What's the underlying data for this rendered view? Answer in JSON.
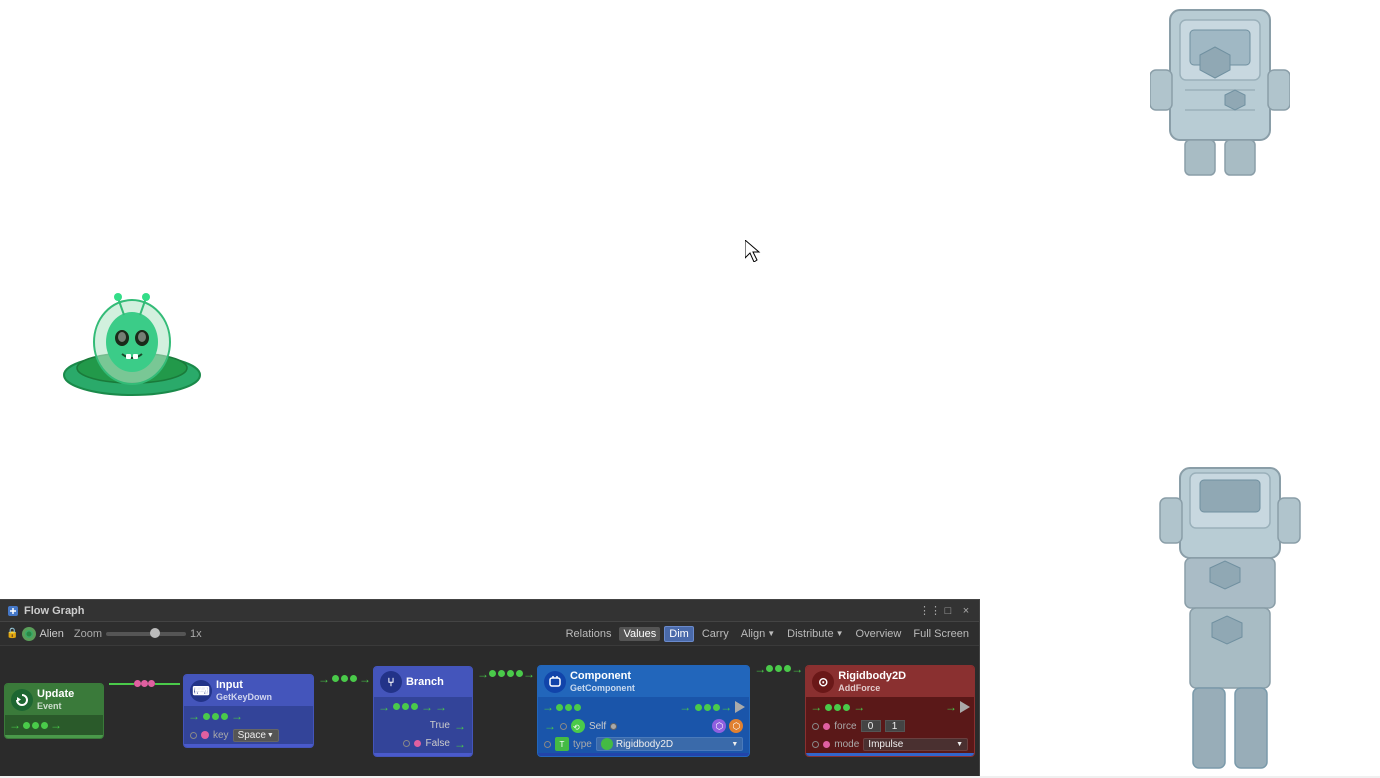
{
  "canvas": {
    "background": "#ffffff"
  },
  "panel": {
    "title": "Flow Graph",
    "title_icon": "🔷",
    "alien_label": "Alien",
    "zoom_label": "Zoom",
    "zoom_value": "1x",
    "toolbar_buttons": [
      {
        "label": "Relations",
        "id": "relations",
        "active": false
      },
      {
        "label": "Values",
        "id": "values",
        "active": false
      },
      {
        "label": "Dim",
        "id": "dim",
        "active": true
      },
      {
        "label": "Carry",
        "id": "carry",
        "active": false
      },
      {
        "label": "Align",
        "id": "align",
        "active": false,
        "dropdown": true
      },
      {
        "label": "Distribute",
        "id": "distribute",
        "active": false,
        "dropdown": true
      },
      {
        "label": "Overview",
        "id": "overview",
        "active": false
      },
      {
        "label": "Full Screen",
        "id": "fullscreen",
        "active": false
      }
    ],
    "controls": [
      "⋮⋮",
      "□",
      "×"
    ]
  },
  "nodes": [
    {
      "id": "update",
      "type": "update",
      "title": "Update",
      "subtitle": "Event",
      "icon_color": "#2d8a3e",
      "header_color": "#3a7a3a",
      "bg_color": "#2a5a2a",
      "icon_symbol": "↺"
    },
    {
      "id": "input",
      "type": "input",
      "title": "Input",
      "subtitle": "GetKeyDown",
      "icon_color": "#223388",
      "header_color": "#4455bb",
      "bg_color": "#334499",
      "icon_symbol": "⌨"
    },
    {
      "id": "branch",
      "type": "branch",
      "title": "Branch",
      "subtitle": "",
      "icon_color": "#223388",
      "header_color": "#4455bb",
      "bg_color": "#334499",
      "icon_symbol": "⑂"
    },
    {
      "id": "component",
      "type": "component",
      "title": "Component",
      "subtitle": "GetComponent",
      "icon_color": "#1144aa",
      "header_color": "#2266bb",
      "bg_color": "#1a55aa",
      "icon_symbol": "⟲"
    },
    {
      "id": "rigidbody",
      "type": "rigidbody",
      "title": "Rigidbody2D",
      "subtitle": "AddForce",
      "icon_color": "#8a1a1a",
      "header_color": "#9a3030",
      "bg_color": "#6a2020",
      "icon_symbol": "⊙"
    }
  ],
  "fields": {
    "key_label": "key",
    "key_value": "Space",
    "true_label": "True",
    "false_label": "False",
    "self_label": "Self",
    "type_label": "type",
    "type_value": "Rigidbody2D",
    "force_label": "force",
    "force_x": "0",
    "force_y": "1",
    "mode_label": "mode",
    "mode_value": "Impulse"
  }
}
